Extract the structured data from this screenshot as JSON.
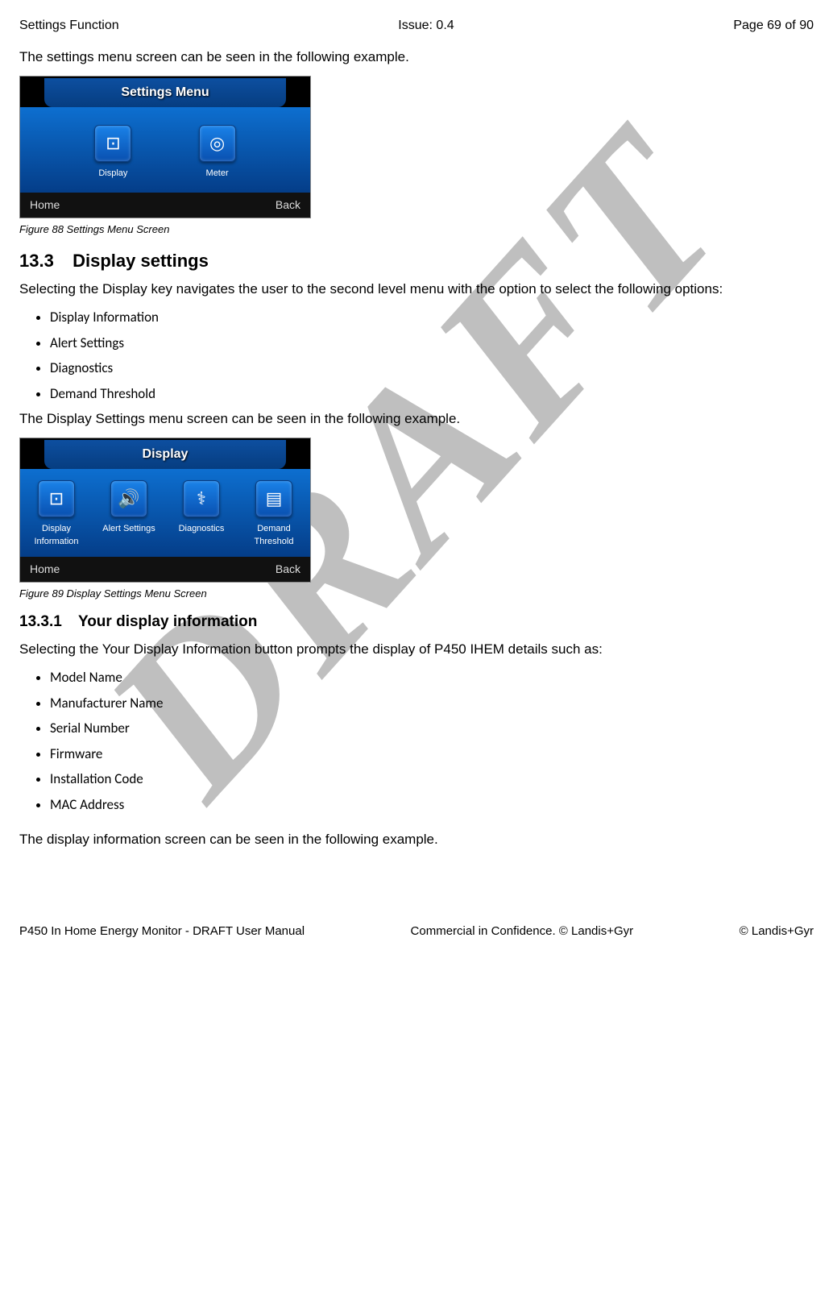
{
  "header": {
    "left": "Settings Function",
    "center": "Issue: 0.4",
    "right": "Page 69 of 90"
  },
  "intro": "The settings menu screen can be seen in the following example.",
  "fig88": {
    "title": "Settings Menu",
    "items": [
      {
        "icon": "⊡",
        "label": "Display"
      },
      {
        "icon": "◎",
        "label": "Meter"
      }
    ],
    "home": "Home",
    "back": "Back",
    "caption": "Figure 88 Settings Menu Screen"
  },
  "s133": {
    "num": "13.3",
    "title": "Display settings",
    "lead": "Selecting the Display key navigates the user to the second level menu with the option to select the following options:",
    "bullets": [
      "Display Information",
      "Alert Settings",
      "Diagnostics",
      "Demand Threshold"
    ],
    "tail": "The Display Settings menu screen can be seen in the following example."
  },
  "fig89": {
    "title": "Display",
    "items": [
      {
        "icon": "⊡",
        "label": "Display Information"
      },
      {
        "icon": "🔊",
        "label": "Alert Settings"
      },
      {
        "icon": "⚕",
        "label": "Diagnostics"
      },
      {
        "icon": "▤",
        "label": "Demand Threshold"
      }
    ],
    "home": "Home",
    "back": "Back",
    "caption": "Figure 89 Display Settings Menu Screen"
  },
  "s1331": {
    "num": "13.3.1",
    "title": "Your display information",
    "lead": "Selecting the Your Display Information button prompts the display of P450 IHEM details such as:",
    "bullets": [
      "Model Name",
      "Manufacturer Name",
      "Serial Number",
      "Firmware",
      "Installation Code",
      "MAC Address"
    ],
    "tail": "The display information screen can be seen in the following example."
  },
  "footer": {
    "left": "P450 In Home Energy Monitor - DRAFT User Manual",
    "center": "Commercial in Confidence. © Landis+Gyr",
    "right": "© Landis+Gyr"
  },
  "watermark": "DRAFT"
}
